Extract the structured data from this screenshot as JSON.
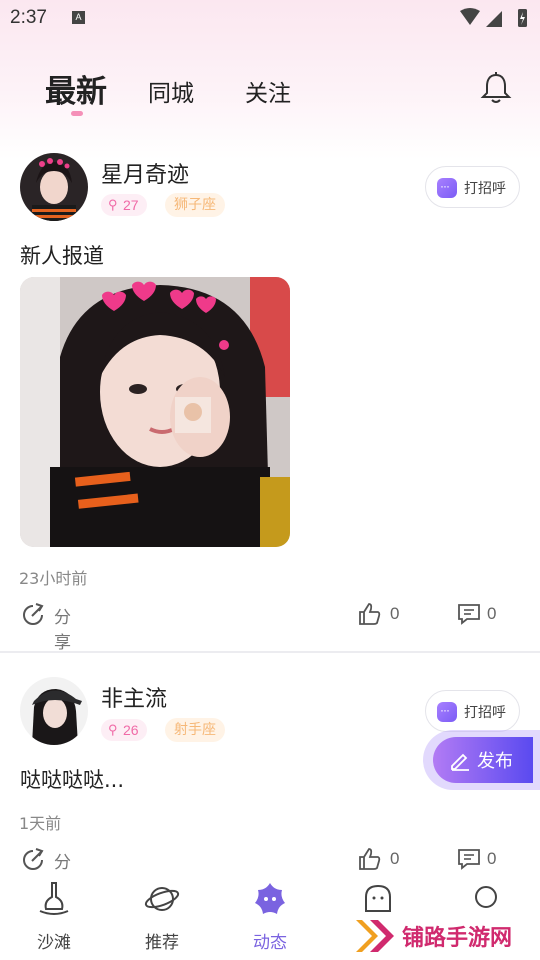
{
  "status_bar": {
    "time": "2:37",
    "notification_glyph": "A"
  },
  "tabs": [
    {
      "label": "最新",
      "active": true
    },
    {
      "label": "同城",
      "active": false
    },
    {
      "label": "关注",
      "active": false
    }
  ],
  "posts": [
    {
      "username": "星月奇迹",
      "level": "27",
      "zodiac": "狮子座",
      "greet_label": "打招呼",
      "text": "新人报道",
      "timestamp": "23小时前",
      "share_label": "分享",
      "likes": "0",
      "comments": "0"
    },
    {
      "username": "非主流",
      "level": "26",
      "zodiac": "射手座",
      "greet_label": "打招呼",
      "text": "哒哒哒哒...",
      "timestamp": "1天前",
      "share_label": "分享",
      "likes": "0",
      "comments": "0"
    }
  ],
  "publish_button": {
    "label": "发布"
  },
  "bottom_nav": [
    {
      "label": "沙滩",
      "icon": "shovel-icon",
      "active": false
    },
    {
      "label": "推荐",
      "icon": "planet-icon",
      "active": false
    },
    {
      "label": "动态",
      "icon": "star-face-icon",
      "active": true
    },
    {
      "label": "",
      "icon": "chat-ghost-icon",
      "active": false
    },
    {
      "label": "",
      "icon": "profile-circle-icon",
      "active": false
    }
  ],
  "watermark": {
    "text": "铺路手游网"
  },
  "colors": {
    "accent": "#7a63e0",
    "pink": "#f06aa7",
    "tab_indicator": "#f590b8"
  }
}
